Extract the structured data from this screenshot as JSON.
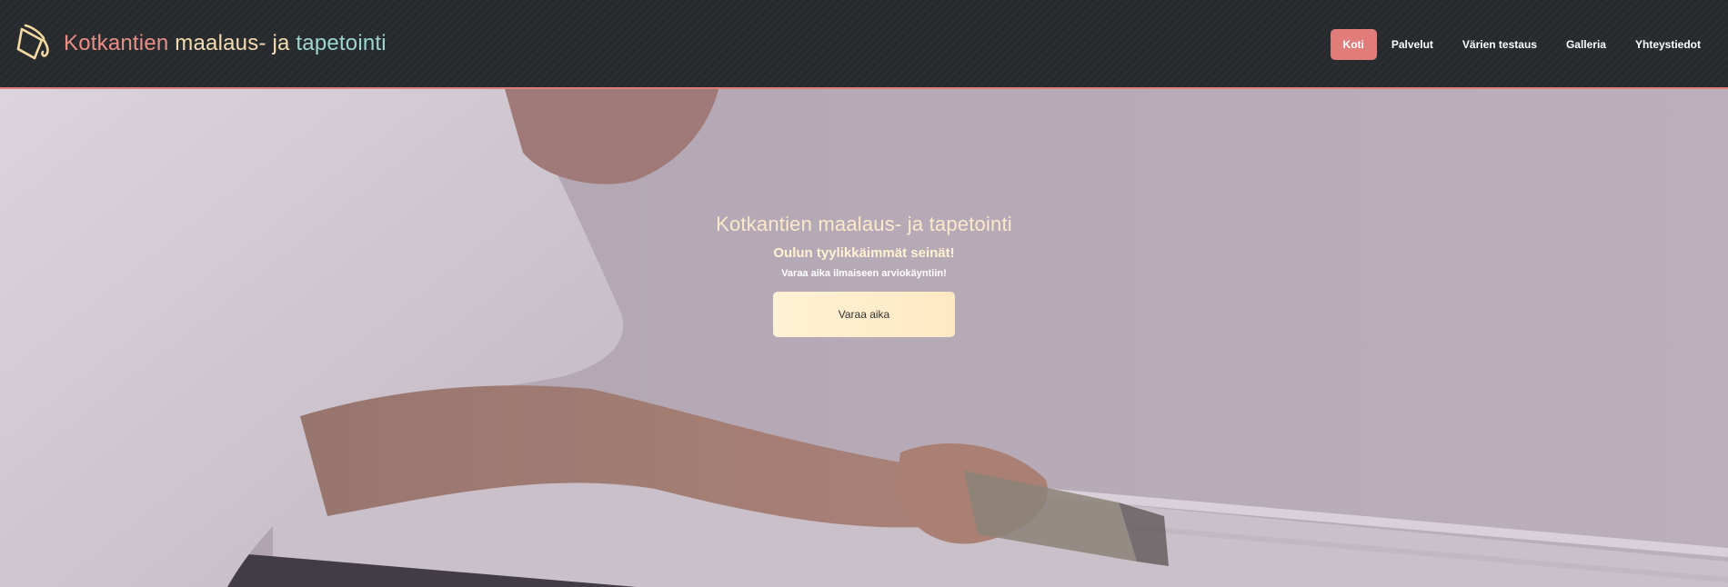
{
  "brand": {
    "icon": "paint-bucket-icon",
    "title_part1": "Kotkantien",
    "title_part2": " maalaus- ja ",
    "title_part3": "tapetointi",
    "colors": {
      "part1": "#e98f87",
      "part2": "#f5dcb0",
      "part3": "#9fd5cf"
    }
  },
  "nav": {
    "items": [
      {
        "label": "Koti",
        "active": true
      },
      {
        "label": "Palvelut",
        "active": false
      },
      {
        "label": "Värien testaus",
        "active": false
      },
      {
        "label": "Galleria",
        "active": false
      },
      {
        "label": "Yhteystiedot",
        "active": false
      }
    ],
    "active_color": "#e07c7a"
  },
  "hero": {
    "title": "Kotkantien maalaus- ja tapetointi",
    "subtitle": "Oulun tyylikkäimmät seinät!",
    "text": "Varaa aika ilmaiseen arviokäyntiin!",
    "cta_label": "Varaa aika",
    "image": "painter-painting-baseboard-photo"
  }
}
